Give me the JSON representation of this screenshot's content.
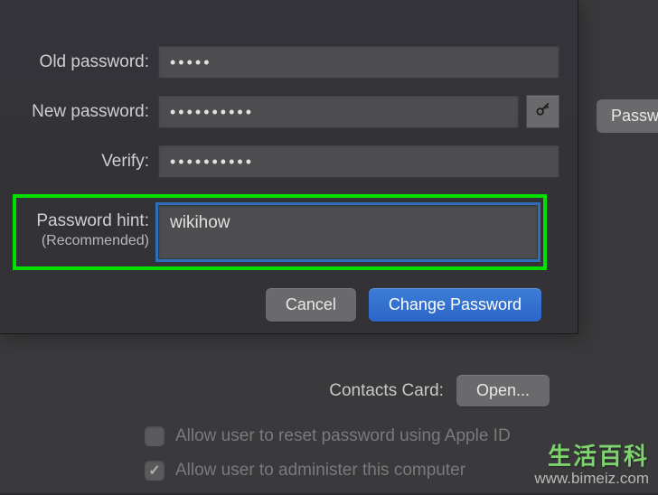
{
  "dialog": {
    "old_password_label": "Old password:",
    "old_password_value": "•••••",
    "new_password_label": "New password:",
    "new_password_value": "••••••••••",
    "verify_label": "Verify:",
    "verify_value": "••••••••••",
    "hint_label": "Password hint:",
    "hint_sublabel": "(Recommended)",
    "hint_value": "wikihow",
    "cancel_button": "Cancel",
    "change_button": "Change Password"
  },
  "background": {
    "password_button": "Password",
    "contacts_label": "Contacts Card:",
    "open_button": "Open...",
    "checkbox1_label": "Allow user to reset password using Apple ID",
    "checkbox2_label": "Allow user to administer this computer"
  },
  "watermark": {
    "cn": "生活百科",
    "url": "www.bimeiz.com"
  }
}
